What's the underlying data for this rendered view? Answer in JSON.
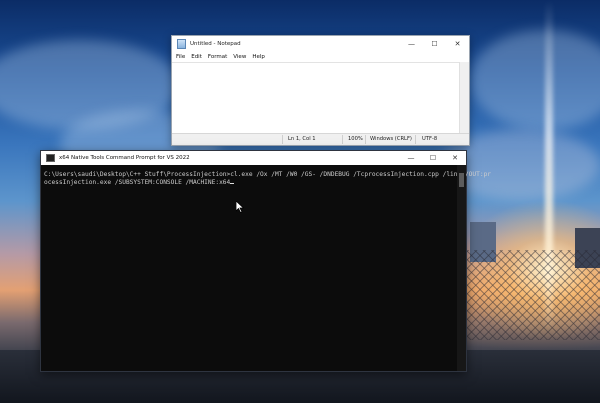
{
  "notepad": {
    "title": "Untitled - Notepad",
    "menu": [
      "File",
      "Edit",
      "Format",
      "View",
      "Help"
    ],
    "status": {
      "position": "Ln 1, Col 1",
      "zoom": "100%",
      "line_ending": "Windows (CRLF)",
      "encoding": "UTF-8"
    },
    "controls": {
      "minimize": "—",
      "maximize": "☐",
      "close": "✕"
    }
  },
  "terminal": {
    "title": "x64 Native Tools Command Prompt for VS 2022",
    "lines": [
      "C:\\Users\\saudi\\Desktop\\C++ Stuff\\ProcessInjection>cl.exe /Ox /MT /W0 /GS- /DNDEBUG /TcprocessInjection.cpp /link /OUT:pr",
      "ocessInjection.exe /SUBSYSTEM:CONSOLE /MACHINE:x64"
    ],
    "controls": {
      "minimize": "—",
      "maximize": "☐",
      "close": "✕"
    }
  }
}
